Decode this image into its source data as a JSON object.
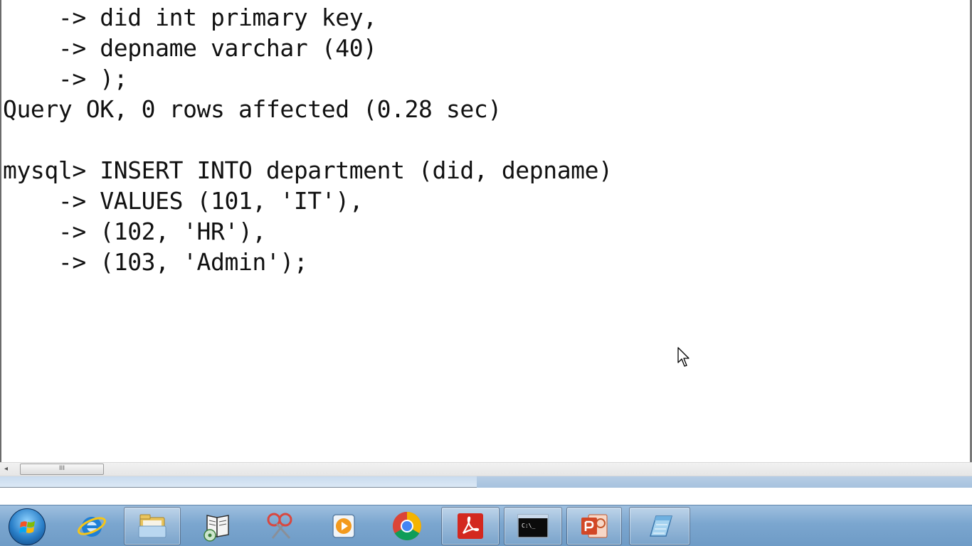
{
  "console": {
    "lines": [
      "    -> did int primary key,",
      "    -> depname varchar (40)",
      "    -> );",
      "Query OK, 0 rows affected (0.28 sec)",
      "",
      "mysql> INSERT INTO department (did, depname)",
      "    -> VALUES (101, 'IT'),",
      "    -> (102, 'HR'),",
      "    -> (103, 'Admin');"
    ]
  },
  "scrollbar": {
    "left_arrow": "◂",
    "thumb_grip": "III"
  },
  "taskbar": {
    "items": [
      {
        "name": "start-button",
        "icon": "windows-start-orb"
      },
      {
        "name": "internet-explorer",
        "icon": "ie-icon"
      },
      {
        "name": "windows-explorer",
        "icon": "folder-icon"
      },
      {
        "name": "reader-app",
        "icon": "book-cd-icon"
      },
      {
        "name": "snipping-tool",
        "icon": "scissors-icon"
      },
      {
        "name": "media-player",
        "icon": "play-icon"
      },
      {
        "name": "google-chrome",
        "icon": "chrome-icon"
      },
      {
        "name": "adobe-reader",
        "icon": "pdf-icon"
      },
      {
        "name": "command-prompt",
        "icon": "cmd-icon"
      },
      {
        "name": "powerpoint",
        "icon": "powerpoint-icon"
      },
      {
        "name": "notepad",
        "icon": "notepad-icon"
      }
    ],
    "cmd_label": "C:\\_"
  },
  "colors": {
    "console_bg": "#ffffff",
    "console_text": "#111111",
    "taskbar": "#7ba6cf"
  }
}
